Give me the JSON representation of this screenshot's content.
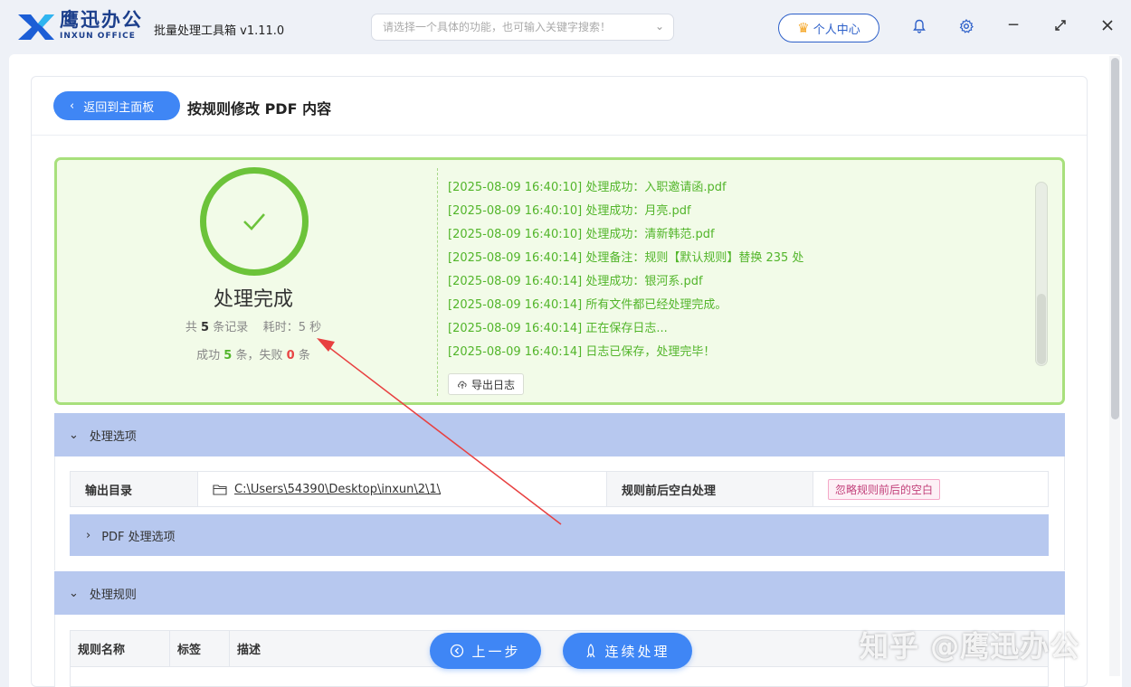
{
  "app": {
    "brand_cn": "鹰迅办公",
    "brand_en": "INXUN OFFICE",
    "title": "批量处理工具箱 v1.11.0"
  },
  "search": {
    "placeholder": "请选择一个具体的功能，也可输入关键字搜索！"
  },
  "header": {
    "user_center": "个人中心"
  },
  "page": {
    "back_label": "返回到主面板",
    "title": "按规则修改 PDF 内容"
  },
  "result": {
    "status": "处理完成",
    "total_prefix": "共",
    "total": "5",
    "total_suffix": "条记录",
    "time_label": "耗时：",
    "time_value": "5 秒",
    "success_prefix": "成功",
    "success": "5",
    "success_suffix": "条，失败",
    "fail": "0",
    "fail_suffix": "条",
    "log": [
      "[2025-08-09 16:40:10] 处理成功：入职邀请函.pdf",
      "[2025-08-09 16:40:10] 处理成功：月亮.pdf",
      "[2025-08-09 16:40:10] 处理成功：清新韩范.pdf",
      "[2025-08-09 16:40:14] 处理备注：规则【默认规则】替换 235 处",
      "[2025-08-09 16:40:14] 处理成功：银河系.pdf",
      "[2025-08-09 16:40:14] 所有文件都已经处理完成。",
      "[2025-08-09 16:40:14] 正在保存日志...",
      "[2025-08-09 16:40:14] 日志已保存，处理完毕！"
    ],
    "export_label": "导出日志"
  },
  "options": {
    "header": "处理选项",
    "output_label": "输出目录",
    "output_path": "C:\\Users\\54390\\Desktop\\inxun\\2\\1\\",
    "whitespace_label": "规则前后空白处理",
    "whitespace_value": "忽略规则前后的空白",
    "pdf_options": "PDF 处理选项"
  },
  "rules": {
    "header": "处理规则",
    "columns": [
      "规则名称",
      "标签",
      "描述"
    ]
  },
  "footer": {
    "prev": "上一步",
    "continue": "连续处理"
  },
  "watermark": "知乎 @鹰迅办公",
  "colors": {
    "accent": "#3f86f5",
    "success": "#52b52a",
    "fail": "#e84545",
    "section": "#b7c8ef"
  }
}
